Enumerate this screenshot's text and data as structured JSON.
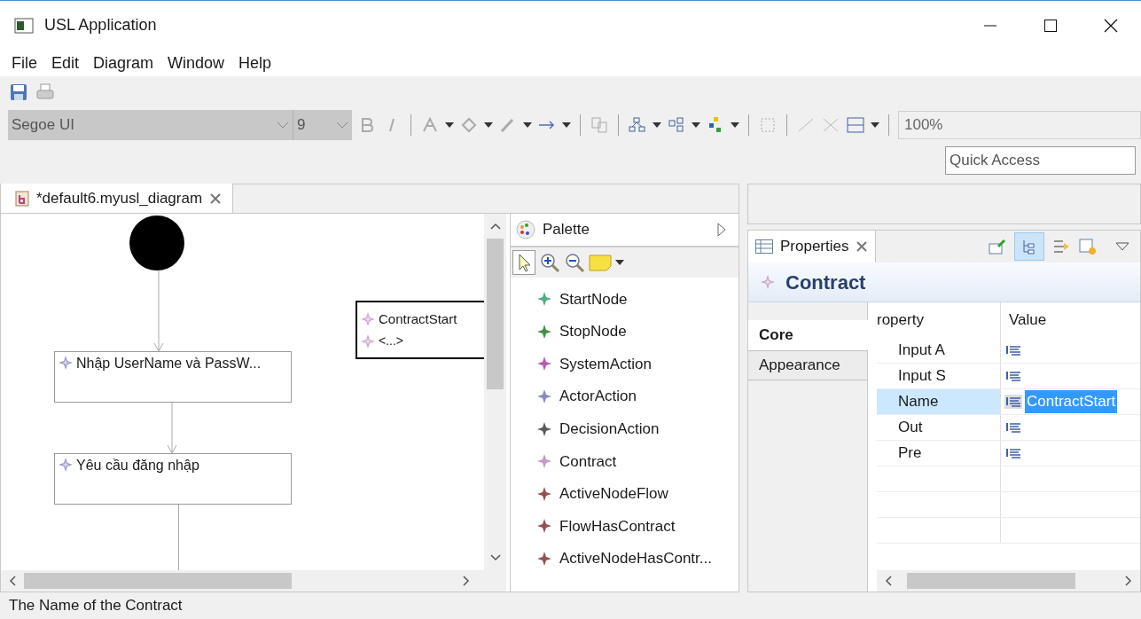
{
  "window": {
    "title": "USL Application"
  },
  "menu": [
    "File",
    "Edit",
    "Diagram",
    "Window",
    "Help"
  ],
  "toolbar": {
    "font": "Segoe UI",
    "size": "9",
    "zoom": "100%"
  },
  "quick_access": {
    "placeholder": "Quick Access"
  },
  "editor": {
    "tab": "*default6.myusl_diagram",
    "nodes": [
      {
        "kind": "start"
      },
      {
        "kind": "action",
        "label": "Nhập UserName và PassW..."
      },
      {
        "kind": "action",
        "label": "Yêu cầu đăng nhập"
      },
      {
        "kind": "contract",
        "label": "ContractStart",
        "detail": "<...>",
        "selected": true
      }
    ]
  },
  "palette": {
    "title": "Palette",
    "items": [
      {
        "label": "StartNode",
        "color": "#4fae80"
      },
      {
        "label": "StopNode",
        "color": "#3f8f45"
      },
      {
        "label": "SystemAction",
        "color": "#b45cb4"
      },
      {
        "label": "ActorAction",
        "color": "#8a8ac0"
      },
      {
        "label": "DecisionAction",
        "color": "#5a5a5a"
      },
      {
        "label": "Contract",
        "color": "#c49ac4"
      },
      {
        "label": "ActiveNodeFlow",
        "color": "#955050"
      },
      {
        "label": "FlowHasContract",
        "color": "#955050"
      },
      {
        "label": "ActiveNodeHasContr...",
        "color": "#955050"
      }
    ]
  },
  "properties": {
    "tab": "Properties",
    "title": "Contract",
    "sections": [
      {
        "label": "Core",
        "selected": true
      },
      {
        "label": "Appearance",
        "selected": false
      }
    ],
    "columns": [
      "roperty",
      "Value"
    ],
    "rows": [
      {
        "property": "Input A",
        "selected": false
      },
      {
        "property": "Input S",
        "selected": false
      },
      {
        "property": "Name",
        "value": "ContractStart",
        "selected": true
      },
      {
        "property": "Out",
        "selected": false
      },
      {
        "property": "Pre",
        "selected": false
      }
    ]
  },
  "status_bar": "The Name of the Contract"
}
